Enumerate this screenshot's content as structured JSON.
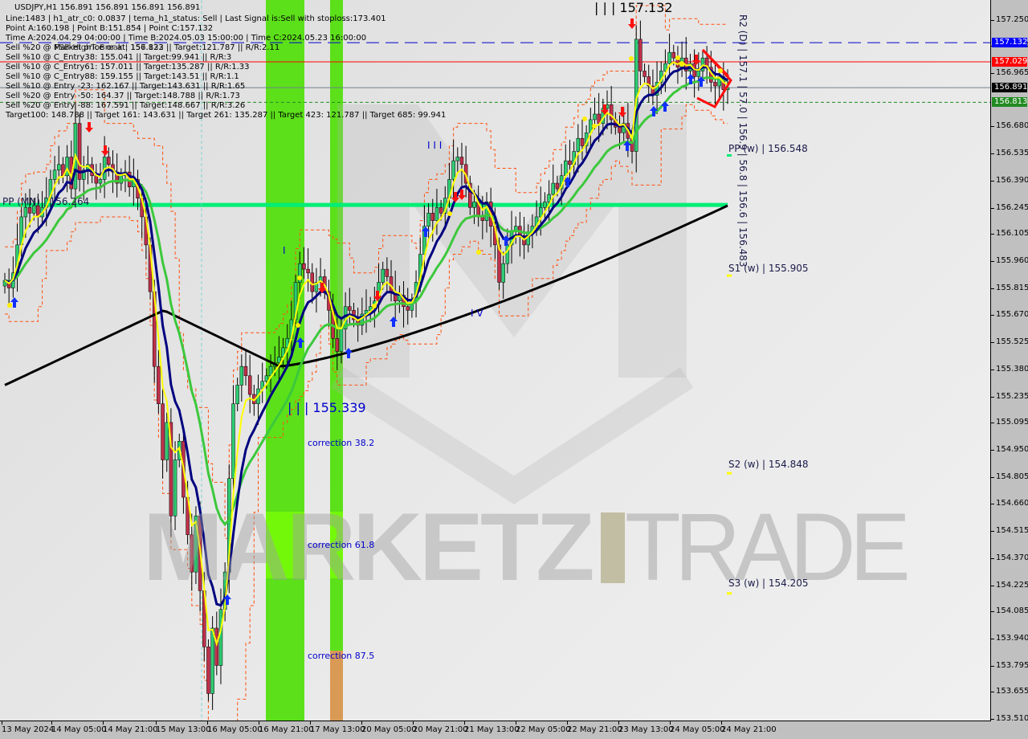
{
  "header": {
    "symbol_line": "USDJPY,H1  156.891 156.891 156.891 156.891",
    "lines": [
      "Line:1483 | h1_atr_c0: 0.0837 | tema_h1_status: Sell | Last Signal is:Sell with stoploss:173.401",
      "Point A:160.198 | Point B:151.854 | Point C:157.132",
      "Time A:2024.04.29 04:00:00 | Time B:2024.05.03 15:00:00 | Time C:2024.05.23 16:00:00",
      "Sell %20 @ Market price or at: 156.823 || Target:121.787 || R/R:2.11",
      "Sell %10 @ C_Entry38: 155.041 || Target:99.941 || R/R:3",
      "Sell %10 @ C_Entry61: 157.011 || Target:135.287 || R/R:1.33",
      "Sell %10 @ C_Entry88: 159.155 || Target:143.51 || R/R:1.1",
      "Sell %10 @ Entry -23: 162.167 || Target:143.631 || R/R:1.65",
      "Sell %20 @ Entry -50: 164.37 || Target:148.788 || R/R:1.73",
      "Sell %20 @ Entry -88: 167.591 || Target:148.667 || R/R:3.26",
      "Target100: 148.788 || Target 161: 143.631 || Target 261: 135.287 || Target 423: 121.787 || Target 685: 99.941"
    ],
    "fsb_label": "FSB-HighToBreak | 157.132"
  },
  "annotations": {
    "wave3_top": "| | | 157.132",
    "wave3_bottom": "| | | 155.339",
    "wave_i": "I",
    "wave_iii": "I I I",
    "wave_iv": "I V",
    "correction_382": "correction 38.2",
    "correction_618": "correction 61.8",
    "correction_875": "correction 87.5",
    "pp_mn": "PP (MN) | 156.264",
    "pp_w": "PP (w) | 156.548",
    "s1_w": "S1 (w) | 155.905",
    "s2_w": "S2 (w) | 154.848",
    "s3_w": "S3 (w) | 154.205",
    "r2_d_vertical": "R2 (D) | 157.1 | 57.0 | 156.9 | 56.8 | 156.6 | 156.483"
  },
  "watermark": {
    "part1": "MARKETZ",
    "part2": "TRADE"
  },
  "price_labels": [
    {
      "value": "157.132",
      "color": "#0000ff",
      "name": "fsb-high-label"
    },
    {
      "value": "157.029",
      "color": "#ff0000",
      "name": "entry-label"
    },
    {
      "value": "156.891",
      "color": "#000000",
      "name": "current-price-label"
    },
    {
      "value": "156.813",
      "color": "#228b22",
      "name": "target-label"
    }
  ],
  "chart_data": {
    "type": "candlestick",
    "title": "USDJPY,H1",
    "ylim": [
      153.51,
      157.33
    ],
    "yticks": [
      "157.250",
      "157.110",
      "156.965",
      "156.680",
      "156.535",
      "156.390",
      "156.245",
      "156.105",
      "155.960",
      "155.815",
      "155.670",
      "155.525",
      "155.380",
      "155.235",
      "155.095",
      "154.950",
      "154.805",
      "154.660",
      "154.515",
      "154.370",
      "154.225",
      "154.085",
      "153.940",
      "153.795",
      "153.655",
      "153.510"
    ],
    "xticks": [
      "13 May 2024",
      "14 May 05:00",
      "14 May 21:00",
      "15 May 13:00",
      "16 May 05:00",
      "16 May 21:00",
      "17 May 13:00",
      "20 May 05:00",
      "20 May 21:00",
      "21 May 13:00",
      "22 May 05:00",
      "22 May 21:00",
      "23 May 13:00",
      "24 May 05:00",
      "24 May 21:00"
    ],
    "levels": [
      {
        "name": "FSB-HighToBreak",
        "value": 157.132,
        "color": "#0000cc",
        "style": "dashed"
      },
      {
        "name": "C_Entry61",
        "value": 157.029,
        "color": "#ff0000",
        "style": "solid"
      },
      {
        "name": "Current",
        "value": 156.891,
        "color": "#708090",
        "style": "solid"
      },
      {
        "name": "Market entry",
        "value": 156.813,
        "color": "#228b22",
        "style": "dotted"
      },
      {
        "name": "PP (MN)",
        "value": 156.264,
        "color": "#00ee76",
        "style": "thick"
      }
    ],
    "pivots_weekly": [
      {
        "label": "PP (w)",
        "value": 156.548
      },
      {
        "label": "S1 (w)",
        "value": 155.905
      },
      {
        "label": "S2 (w)",
        "value": 154.848
      },
      {
        "label": "S3 (w)",
        "value": 154.205
      }
    ],
    "close_series": [
      155.86,
      155.82,
      155.9,
      156.05,
      156.2,
      156.25,
      156.22,
      156.26,
      156.2,
      156.25,
      156.3,
      156.4,
      156.45,
      156.48,
      156.42,
      156.52,
      156.35,
      156.7,
      156.4,
      156.45,
      156.48,
      156.42,
      156.38,
      156.4,
      156.52,
      156.48,
      156.44,
      156.38,
      156.42,
      156.44,
      156.36,
      156.4,
      156.3,
      156.2,
      156.05,
      155.8,
      155.4,
      155.2,
      154.9,
      155.1,
      154.6,
      154.9,
      155.0,
      154.7,
      154.5,
      154.3,
      154.6,
      154.2,
      153.9,
      153.65,
      154.0,
      153.8,
      154.1,
      154.3,
      154.8,
      155.2,
      155.3,
      155.4,
      155.35,
      155.25,
      155.2,
      155.28,
      155.32,
      155.35,
      155.4,
      155.42,
      155.45,
      155.5,
      155.55,
      155.65,
      155.85,
      155.95,
      155.92,
      155.9,
      155.8,
      155.85,
      155.88,
      155.8,
      155.7,
      155.55,
      155.48,
      155.6,
      155.72,
      155.7,
      155.65,
      155.62,
      155.68,
      155.7,
      155.72,
      155.75,
      155.85,
      155.92,
      155.88,
      155.8,
      155.75,
      155.78,
      155.72,
      155.7,
      155.75,
      155.85,
      156.0,
      156.15,
      156.22,
      156.18,
      156.25,
      156.22,
      156.3,
      156.4,
      156.5,
      156.52,
      156.48,
      156.38,
      156.25,
      156.28,
      156.2,
      156.18,
      156.28,
      156.15,
      156.05,
      155.85,
      155.95,
      156.05,
      156.12,
      156.15,
      156.1,
      156.05,
      156.12,
      156.15,
      156.2,
      156.25,
      156.28,
      156.32,
      156.38,
      156.35,
      156.42,
      156.5,
      156.48,
      156.55,
      156.62,
      156.58,
      156.65,
      156.72,
      156.75,
      156.7,
      156.78,
      156.8,
      156.72,
      156.68,
      156.65,
      156.7,
      156.62,
      156.55,
      157.15,
      156.98,
      156.95,
      156.9,
      156.85,
      156.92,
      156.98,
      157.02,
      157.08,
      157.05,
      157.0,
      157.05,
      156.98,
      157.02,
      156.95,
      156.98,
      157.05,
      157.0,
      156.92,
      156.9,
      156.95,
      156.88,
      156.89
    ],
    "series": [
      {
        "name": "EMA fast (yellow)",
        "color": "#ffff00"
      },
      {
        "name": "EMA (navy)",
        "color": "#000080"
      },
      {
        "name": "EMA (green)",
        "color": "#32cd32"
      },
      {
        "name": "EMA 200 (black)",
        "color": "#000000"
      }
    ],
    "zones": [
      {
        "name": "correction zone 1",
        "from_index": 58,
        "to_index": 65,
        "color": "#5ce01a"
      },
      {
        "name": "correction zone 2",
        "from_index": 71,
        "to_index": 73,
        "color": "#5ce01a"
      }
    ]
  }
}
